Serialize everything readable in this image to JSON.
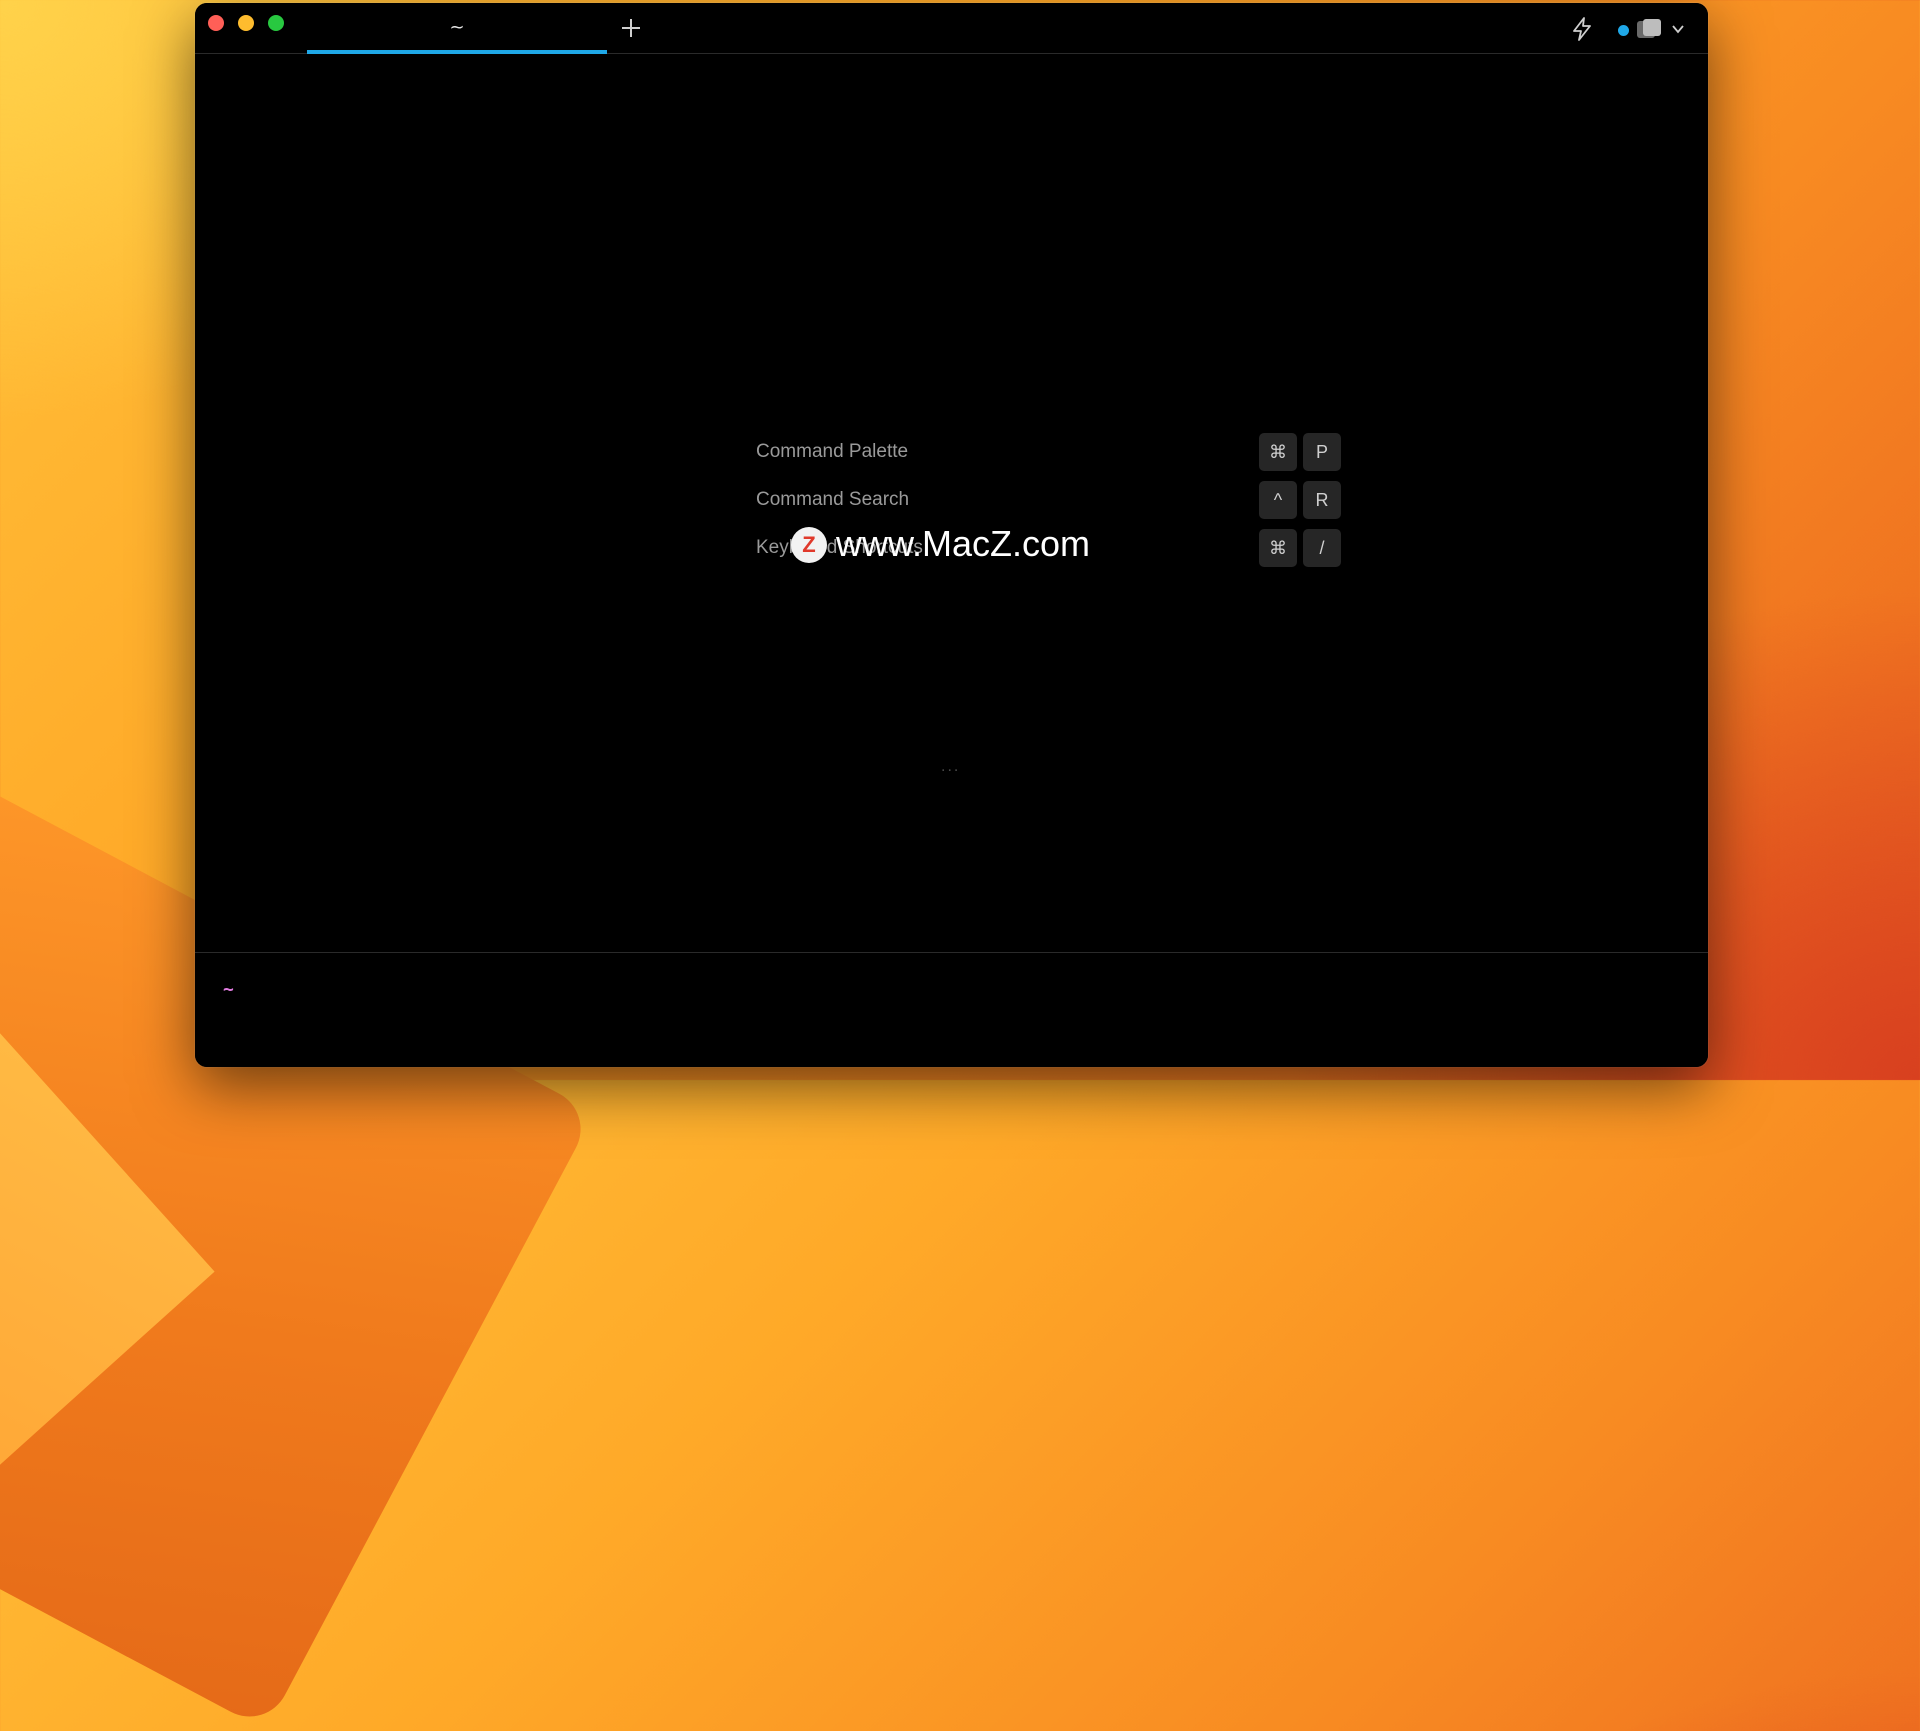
{
  "window": {
    "tab": {
      "title": "~"
    },
    "accent_color": "#1fa8e8"
  },
  "shortcuts": [
    {
      "label": "Command Palette",
      "keys": [
        "⌘",
        "P"
      ]
    },
    {
      "label": "Command Search",
      "keys": [
        "^",
        "R"
      ]
    },
    {
      "label": "Keyboard Shortcuts",
      "keys": [
        "⌘",
        "/"
      ]
    }
  ],
  "watermark": {
    "logo_letter": "Z",
    "text": "www.MacZ.com"
  },
  "ellipsis": "...",
  "input": {
    "prompt": "~"
  },
  "icons": {
    "new_tab": "plus-icon",
    "ai": "lightning-bolt-icon",
    "profile": "profile-icon",
    "menu": "chevron-down-icon"
  }
}
